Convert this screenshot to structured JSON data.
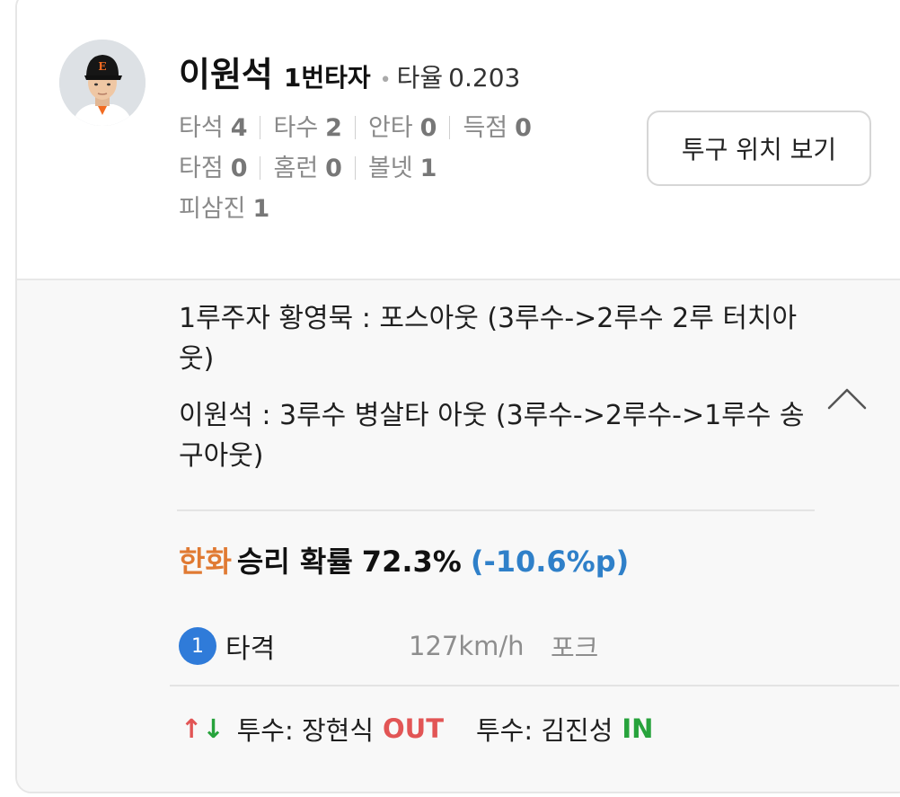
{
  "player": {
    "name": "이원석",
    "batting_order": "1번타자",
    "avg_label": "타율",
    "avg_value": "0.203"
  },
  "stats": [
    {
      "label": "타석",
      "value": "4"
    },
    {
      "label": "타수",
      "value": "2"
    },
    {
      "label": "안타",
      "value": "0"
    },
    {
      "label": "득점",
      "value": "0"
    },
    {
      "label": "타점",
      "value": "0"
    },
    {
      "label": "홈런",
      "value": "0"
    },
    {
      "label": "볼넷",
      "value": "1"
    },
    {
      "label": "피삼진",
      "value": "1"
    }
  ],
  "pitch_location_button": "투구 위치 보기",
  "plays": [
    "1루주자 황영묵 : 포스아웃 (3루수->2루수 2루 터치아웃)",
    "이원석 : 3루수 병살타 아웃 (3루수->2루수->1루수 송구아웃)"
  ],
  "win_probability": {
    "team": "한화",
    "text": "승리 확률",
    "value": "72.3%",
    "change": "(-10.6%p)"
  },
  "pitch": {
    "number": "1",
    "result": "타격",
    "speed": "127km/h",
    "type": "포크"
  },
  "substitution": {
    "out_label": "투수: 장현식",
    "out_tag": "OUT",
    "in_label": "투수: 김진성",
    "in_tag": "IN"
  },
  "colors": {
    "team": "#e07a33",
    "change": "#2f80c9",
    "out": "#e25555",
    "in": "#27a33c",
    "pitch_badge": "#2f7bd9"
  }
}
